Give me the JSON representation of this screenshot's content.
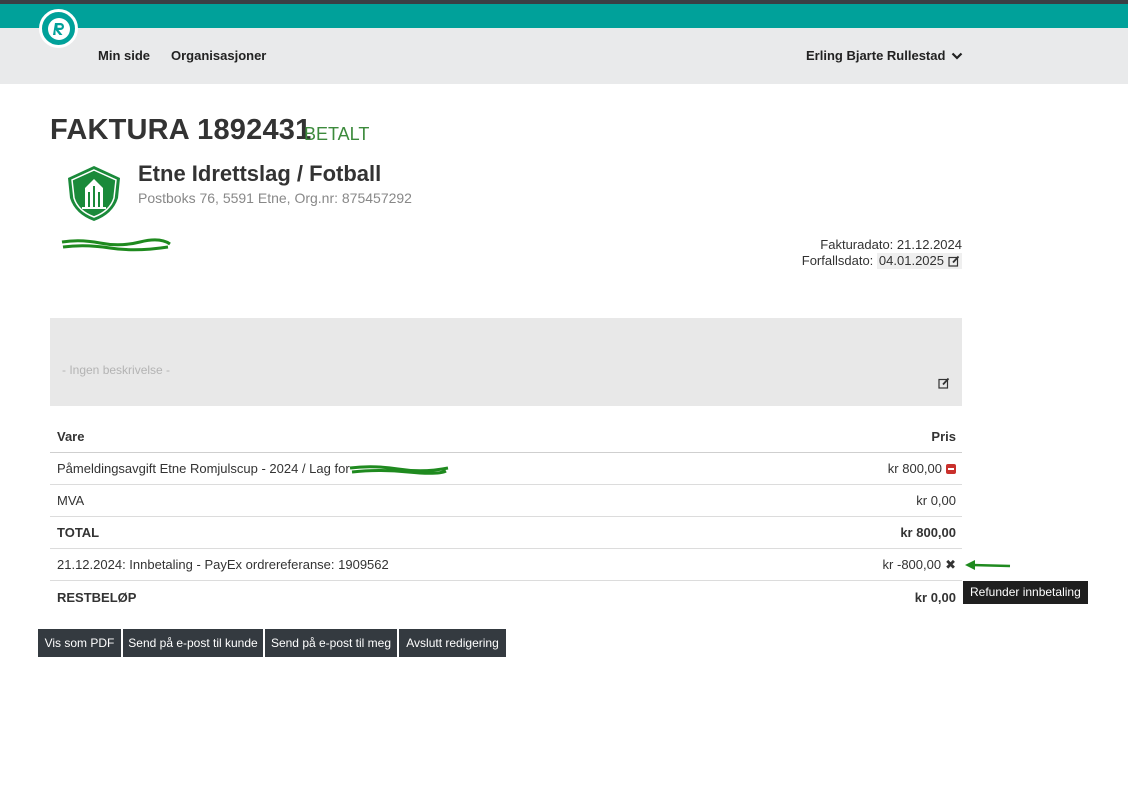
{
  "nav": {
    "links": [
      "Min side",
      "Organisasjoner"
    ],
    "user": "Erling Bjarte Rullestad",
    "brand_color": "#00a19a"
  },
  "invoice": {
    "title": "FAKTURA 1892431",
    "status": "BETALT",
    "status_color": "#3c8a3c"
  },
  "club": {
    "name": "Etne Idrettslag / Fotball",
    "address": "Postboks 76, 5591 Etne, Org.nr: 875457292"
  },
  "dates": {
    "invoice_date_label": "Fakturadato:",
    "invoice_date": "21.12.2024",
    "due_date_label": "Forfallsdato:",
    "due_date": "04.01.2025"
  },
  "description": {
    "placeholder": "- Ingen beskrivelse -"
  },
  "table": {
    "col_item": "Vare",
    "col_price": "Pris",
    "rows": [
      {
        "item": "Påmeldingsavgift Etne Romjulscup - 2024 / Lag for",
        "price": "kr 800,00"
      },
      {
        "item": "MVA",
        "price": "kr 0,00"
      },
      {
        "item": "TOTAL",
        "price": "kr 800,00"
      },
      {
        "item": "21.12.2024: Innbetaling - PayEx ordrereferanse: 1909562",
        "price": "kr -800,00"
      },
      {
        "item": "RESTBELØP",
        "price": "kr 0,00"
      }
    ]
  },
  "tooltip": "Refunder innbetaling",
  "buttons": {
    "pdf": "Vis som PDF",
    "send_customer": "Send på e-post til kunde",
    "send_me": "Send på e-post til meg",
    "finish": "Avslutt redigering"
  }
}
